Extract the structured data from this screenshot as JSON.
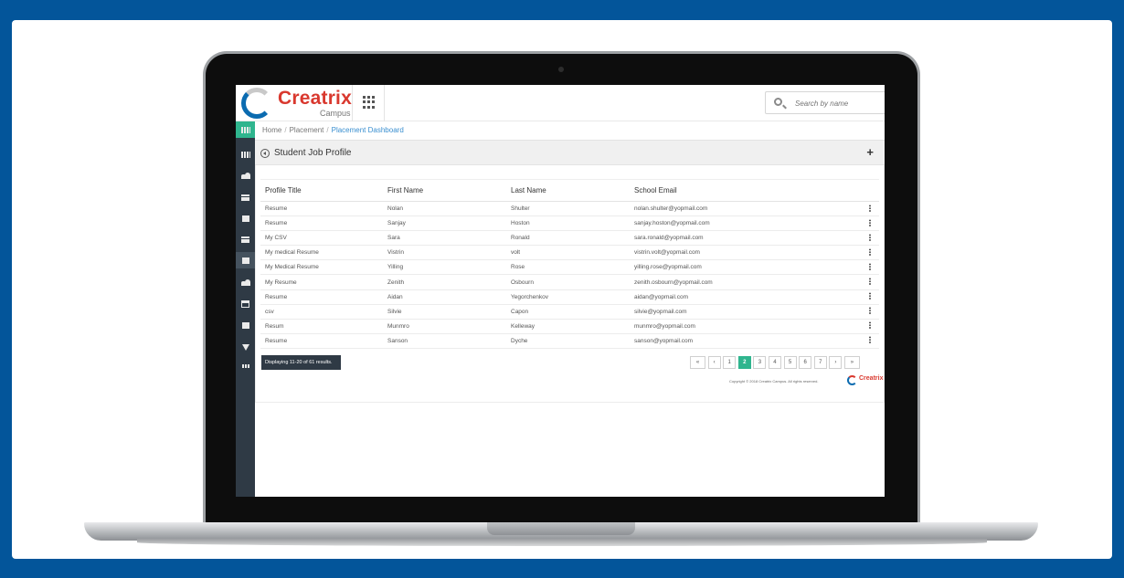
{
  "brand": {
    "name": "Creatrix",
    "sub": "Campus"
  },
  "search": {
    "placeholder": "Search by name"
  },
  "breadcrumb": {
    "items": [
      "Home",
      "Placement"
    ],
    "current": "Placement Dashboard"
  },
  "panel": {
    "title": "Student Job Profile"
  },
  "table": {
    "headers": [
      "Profile Title",
      "First Name",
      "Last Name",
      "School Email"
    ],
    "rows": [
      [
        "Resume",
        "Nolan",
        "Shulter",
        "nolan.shulter@yopmail.com"
      ],
      [
        "Resume",
        "Sanjay",
        "Hoston",
        "sanjay.hoston@yopmail.com"
      ],
      [
        "My CSV",
        "Sara",
        "Ronald",
        "sara.ronald@yopmail.com"
      ],
      [
        "My medical Resume",
        "Vistrin",
        "volt",
        "vistrin.volt@yopmail.com"
      ],
      [
        "My Medical Resume",
        "Yilling",
        "Rose",
        "yilling.rose@yopmail.com"
      ],
      [
        "My Resume",
        "Zenith",
        "Osbourn",
        "zenith.osbourn@yopmail.com"
      ],
      [
        "Resume",
        "Aidan",
        "Yegorchenkov",
        "aidan@yopmail.com"
      ],
      [
        "csv",
        "Silvie",
        "Capon",
        "silvie@yopmail.com"
      ],
      [
        "Resum",
        "Munmro",
        "Kelleway",
        "munmro@yopmail.com"
      ],
      [
        "Resume",
        "Sanson",
        "Dyche",
        "sanson@yopmail.com"
      ]
    ]
  },
  "summary": "Displaying 11-20 of 61 results.",
  "pagination": {
    "first": "«",
    "prev": "‹",
    "pages": [
      "1",
      "2",
      "3",
      "4",
      "5",
      "6",
      "7"
    ],
    "current": "2",
    "next": "›",
    "last": "»"
  },
  "footer": {
    "copyright": "Copyright © 2018 Creatrix Campus. All rights reserved.",
    "logo": "Creatrix"
  },
  "sidebar_icons": [
    "dashboard-icon",
    "columns-icon",
    "users-icon",
    "list-icon",
    "book-icon",
    "list-icon",
    "document-icon",
    "users-icon",
    "calendar-icon",
    "inbox-icon",
    "filter-icon",
    "bars-icon"
  ],
  "colors": {
    "background": "#03559a",
    "accent": "#2fb58e",
    "sidebar": "#2f3a45",
    "brand": "#d9382e",
    "link": "#3a8fd0"
  }
}
